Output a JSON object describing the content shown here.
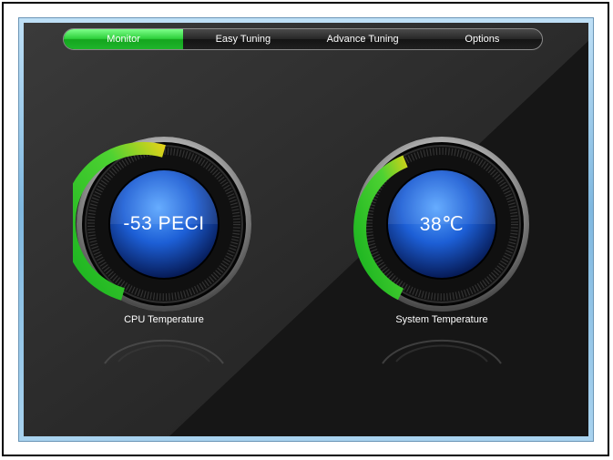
{
  "tabs": [
    {
      "label": "Monitor",
      "active": true
    },
    {
      "label": "Easy Tuning",
      "active": false
    },
    {
      "label": "Advance Tuning",
      "active": false
    },
    {
      "label": "Options",
      "active": false
    }
  ],
  "gauges": {
    "cpu": {
      "value": "-53 PECI",
      "label": "CPU Temperature",
      "fill_fraction": 0.36
    },
    "system": {
      "value": "38℃",
      "label": "System Temperature",
      "fill_fraction": 0.28
    }
  },
  "colors": {
    "accent_green": "#2ccf3a",
    "gauge_yellow": "#e0d21a",
    "gauge_blue": "#1d5fd6",
    "frame_blue": "#7fb8e0"
  }
}
